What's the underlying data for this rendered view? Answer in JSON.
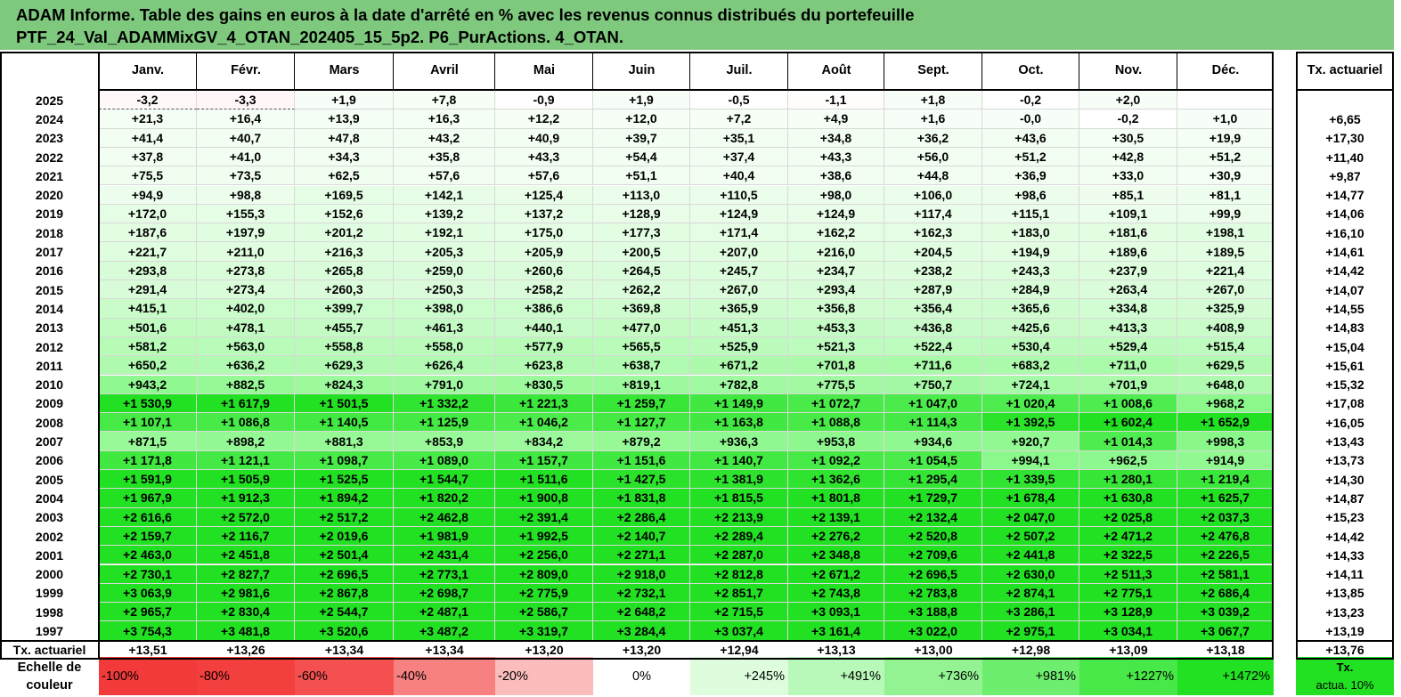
{
  "title": {
    "line1": "ADAM Informe. Table des gains en euros à la date d'arrêté en % avec les revenus connus distribués du portefeuille",
    "line2": "PTF_24_Val_ADAMMixGV_4_OTAN_202405_15_5p2. P6_PurActions. 4_OTAN."
  },
  "months": [
    "Janv.",
    "Févr.",
    "Mars",
    "Avril",
    "Mai",
    "Juin",
    "Juil.",
    "Août",
    "Sept.",
    "Oct.",
    "Nov.",
    "Déc."
  ],
  "rate_header": "Tx. actuariel",
  "rows": [
    {
      "year": "2025",
      "values": [
        "-3,2",
        "-3,3",
        "+1,9",
        "+7,8",
        "-0,9",
        "+1,9",
        "-0,5",
        "-1,1",
        "+1,8",
        "-0,2",
        "+2,0",
        ""
      ],
      "rate": ""
    },
    {
      "year": "2024",
      "values": [
        "+21,3",
        "+16,4",
        "+13,9",
        "+16,3",
        "+12,2",
        "+12,0",
        "+7,2",
        "+4,9",
        "+1,6",
        "-0,0",
        "-0,2",
        "+1,0"
      ],
      "rate": "+6,65"
    },
    {
      "year": "2023",
      "values": [
        "+41,4",
        "+40,7",
        "+47,8",
        "+43,2",
        "+40,9",
        "+39,7",
        "+35,1",
        "+34,8",
        "+36,2",
        "+43,6",
        "+30,5",
        "+19,9"
      ],
      "rate": "+17,30"
    },
    {
      "year": "2022",
      "values": [
        "+37,8",
        "+41,0",
        "+34,3",
        "+35,8",
        "+43,3",
        "+54,4",
        "+37,4",
        "+43,3",
        "+56,0",
        "+51,2",
        "+42,8",
        "+51,2"
      ],
      "rate": "+11,40"
    },
    {
      "year": "2021",
      "values": [
        "+75,5",
        "+73,5",
        "+62,5",
        "+57,6",
        "+57,6",
        "+51,1",
        "+40,4",
        "+38,6",
        "+44,8",
        "+36,9",
        "+33,0",
        "+30,9"
      ],
      "rate": "+9,87"
    },
    {
      "year": "2020",
      "values": [
        "+94,9",
        "+98,8",
        "+169,5",
        "+142,1",
        "+125,4",
        "+113,0",
        "+110,5",
        "+98,0",
        "+106,0",
        "+98,6",
        "+85,1",
        "+81,1"
      ],
      "rate": "+14,77"
    },
    {
      "year": "2019",
      "values": [
        "+172,0",
        "+155,3",
        "+152,6",
        "+139,2",
        "+137,2",
        "+128,9",
        "+124,9",
        "+124,9",
        "+117,4",
        "+115,1",
        "+109,1",
        "+99,9"
      ],
      "rate": "+14,06"
    },
    {
      "year": "2018",
      "values": [
        "+187,6",
        "+197,9",
        "+201,2",
        "+192,1",
        "+175,0",
        "+177,3",
        "+171,4",
        "+162,2",
        "+162,3",
        "+183,0",
        "+181,6",
        "+198,1"
      ],
      "rate": "+16,10"
    },
    {
      "year": "2017",
      "values": [
        "+221,7",
        "+211,0",
        "+216,3",
        "+205,3",
        "+205,9",
        "+200,5",
        "+207,0",
        "+216,0",
        "+204,5",
        "+194,9",
        "+189,6",
        "+189,5"
      ],
      "rate": "+14,61"
    },
    {
      "year": "2016",
      "values": [
        "+293,8",
        "+273,8",
        "+265,8",
        "+259,0",
        "+260,6",
        "+264,5",
        "+245,7",
        "+234,7",
        "+238,2",
        "+243,3",
        "+237,9",
        "+221,4"
      ],
      "rate": "+14,42"
    },
    {
      "year": "2015",
      "values": [
        "+291,4",
        "+273,4",
        "+260,3",
        "+250,3",
        "+258,2",
        "+262,2",
        "+267,0",
        "+293,4",
        "+287,9",
        "+284,9",
        "+263,4",
        "+267,0"
      ],
      "rate": "+14,07"
    },
    {
      "year": "2014",
      "values": [
        "+415,1",
        "+402,0",
        "+399,7",
        "+398,0",
        "+386,6",
        "+369,8",
        "+365,9",
        "+356,8",
        "+356,4",
        "+365,6",
        "+334,8",
        "+325,9"
      ],
      "rate": "+14,55"
    },
    {
      "year": "2013",
      "values": [
        "+501,6",
        "+478,1",
        "+455,7",
        "+461,3",
        "+440,1",
        "+477,0",
        "+451,3",
        "+453,3",
        "+436,8",
        "+425,6",
        "+413,3",
        "+408,9"
      ],
      "rate": "+14,83"
    },
    {
      "year": "2012",
      "values": [
        "+581,2",
        "+563,0",
        "+558,8",
        "+558,0",
        "+577,9",
        "+565,5",
        "+525,9",
        "+521,3",
        "+522,4",
        "+530,4",
        "+529,4",
        "+515,4"
      ],
      "rate": "+15,04"
    },
    {
      "year": "2011",
      "values": [
        "+650,2",
        "+636,2",
        "+629,3",
        "+626,4",
        "+623,8",
        "+638,7",
        "+671,2",
        "+701,8",
        "+711,6",
        "+683,2",
        "+711,0",
        "+629,5"
      ],
      "rate": "+15,61"
    },
    {
      "year": "2010",
      "values": [
        "+943,2",
        "+882,5",
        "+824,3",
        "+791,0",
        "+830,5",
        "+819,1",
        "+782,8",
        "+775,5",
        "+750,7",
        "+724,1",
        "+701,9",
        "+648,0"
      ],
      "rate": "+15,32"
    },
    {
      "year": "2009",
      "values": [
        "+1 530,9",
        "+1 617,9",
        "+1 501,5",
        "+1 332,2",
        "+1 221,3",
        "+1 259,7",
        "+1 149,9",
        "+1 072,7",
        "+1 047,0",
        "+1 020,4",
        "+1 008,6",
        "+968,2"
      ],
      "rate": "+17,08"
    },
    {
      "year": "2008",
      "values": [
        "+1 107,1",
        "+1 086,8",
        "+1 140,5",
        "+1 125,9",
        "+1 046,2",
        "+1 127,7",
        "+1 163,8",
        "+1 088,8",
        "+1 114,3",
        "+1 392,5",
        "+1 602,4",
        "+1 652,9"
      ],
      "rate": "+16,05"
    },
    {
      "year": "2007",
      "values": [
        "+871,5",
        "+898,2",
        "+881,3",
        "+853,9",
        "+834,2",
        "+879,2",
        "+936,3",
        "+953,8",
        "+934,6",
        "+920,7",
        "+1 014,3",
        "+998,3"
      ],
      "rate": "+13,43"
    },
    {
      "year": "2006",
      "values": [
        "+1 171,8",
        "+1 121,1",
        "+1 098,7",
        "+1 089,0",
        "+1 157,7",
        "+1 151,6",
        "+1 140,7",
        "+1 092,2",
        "+1 054,5",
        "+994,1",
        "+962,5",
        "+914,9"
      ],
      "rate": "+13,73"
    },
    {
      "year": "2005",
      "values": [
        "+1 591,9",
        "+1 505,9",
        "+1 525,5",
        "+1 544,7",
        "+1 511,6",
        "+1 427,5",
        "+1 381,9",
        "+1 362,6",
        "+1 295,4",
        "+1 339,5",
        "+1 280,1",
        "+1 219,4"
      ],
      "rate": "+14,30"
    },
    {
      "year": "2004",
      "values": [
        "+1 967,9",
        "+1 912,3",
        "+1 894,2",
        "+1 820,2",
        "+1 900,8",
        "+1 831,8",
        "+1 815,5",
        "+1 801,8",
        "+1 729,7",
        "+1 678,4",
        "+1 630,8",
        "+1 625,7"
      ],
      "rate": "+14,87"
    },
    {
      "year": "2003",
      "values": [
        "+2 616,6",
        "+2 572,0",
        "+2 517,2",
        "+2 462,8",
        "+2 391,4",
        "+2 286,4",
        "+2 213,9",
        "+2 139,1",
        "+2 132,4",
        "+2 047,0",
        "+2 025,8",
        "+2 037,3"
      ],
      "rate": "+15,23"
    },
    {
      "year": "2002",
      "values": [
        "+2 159,7",
        "+2 116,7",
        "+2 019,6",
        "+1 981,9",
        "+1 992,5",
        "+2 140,7",
        "+2 289,4",
        "+2 276,2",
        "+2 520,8",
        "+2 507,2",
        "+2 471,2",
        "+2 476,8"
      ],
      "rate": "+14,42"
    },
    {
      "year": "2001",
      "values": [
        "+2 463,0",
        "+2 451,8",
        "+2 501,4",
        "+2 431,4",
        "+2 256,0",
        "+2 271,1",
        "+2 287,0",
        "+2 348,8",
        "+2 709,6",
        "+2 441,8",
        "+2 322,5",
        "+2 226,5"
      ],
      "rate": "+14,33"
    },
    {
      "year": "2000",
      "values": [
        "+2 730,1",
        "+2 827,7",
        "+2 696,5",
        "+2 773,1",
        "+2 809,0",
        "+2 918,0",
        "+2 812,8",
        "+2 671,2",
        "+2 696,5",
        "+2 630,0",
        "+2 511,3",
        "+2 581,1"
      ],
      "rate": "+14,11"
    },
    {
      "year": "1999",
      "values": [
        "+3 063,9",
        "+2 981,6",
        "+2 867,8",
        "+2 698,7",
        "+2 775,9",
        "+2 732,1",
        "+2 851,7",
        "+2 743,8",
        "+2 783,8",
        "+2 874,1",
        "+2 775,1",
        "+2 686,4"
      ],
      "rate": "+13,85"
    },
    {
      "year": "1998",
      "values": [
        "+2 965,7",
        "+2 830,4",
        "+2 544,7",
        "+2 487,1",
        "+2 586,7",
        "+2 648,2",
        "+2 715,5",
        "+3 093,1",
        "+3 188,8",
        "+3 286,1",
        "+3 128,9",
        "+3 039,2"
      ],
      "rate": "+13,23"
    },
    {
      "year": "1997",
      "values": [
        "+3 754,3",
        "+3 481,8",
        "+3 520,6",
        "+3 487,2",
        "+3 319,7",
        "+3 284,4",
        "+3 037,4",
        "+3 161,4",
        "+3 022,0",
        "+2 975,1",
        "+3 034,1",
        "+3 067,7"
      ],
      "rate": "+13,19"
    }
  ],
  "rate_row": {
    "label": "Tx. actuariel",
    "values": [
      "+13,51",
      "+13,26",
      "+13,34",
      "+13,34",
      "+13,20",
      "+13,20",
      "+12,94",
      "+13,13",
      "+13,00",
      "+12,98",
      "+13,09",
      "+13,18"
    ],
    "total": "+13,76"
  },
  "scale": {
    "label_line1": "Echelle de",
    "label_line2": "couleur",
    "steps": [
      {
        "text": "-100%",
        "color": "#f23a3a",
        "align": "left"
      },
      {
        "text": "-80%",
        "color": "#f43f3f",
        "align": "left"
      },
      {
        "text": "-60%",
        "color": "#f45050",
        "align": "left"
      },
      {
        "text": "-40%",
        "color": "#f78080",
        "align": "left"
      },
      {
        "text": "-20%",
        "color": "#fbbcbc",
        "align": "left"
      },
      {
        "text": "0%",
        "color": "#ffffff",
        "align": "center"
      },
      {
        "text": "+245%",
        "color": "#ddfddd",
        "align": "right"
      },
      {
        "text": "+491%",
        "color": "#b8f8b8",
        "align": "right"
      },
      {
        "text": "+736%",
        "color": "#93f393",
        "align": "right"
      },
      {
        "text": "+981%",
        "color": "#6eee6e",
        "align": "right"
      },
      {
        "text": "+1227%",
        "color": "#47e847",
        "align": "right"
      },
      {
        "text": "+1472%",
        "color": "#22e022",
        "align": "right"
      }
    ],
    "rate_label_line1": "Tx.",
    "rate_label_line2": "actua. 10%",
    "rate_color": "#22e022"
  }
}
